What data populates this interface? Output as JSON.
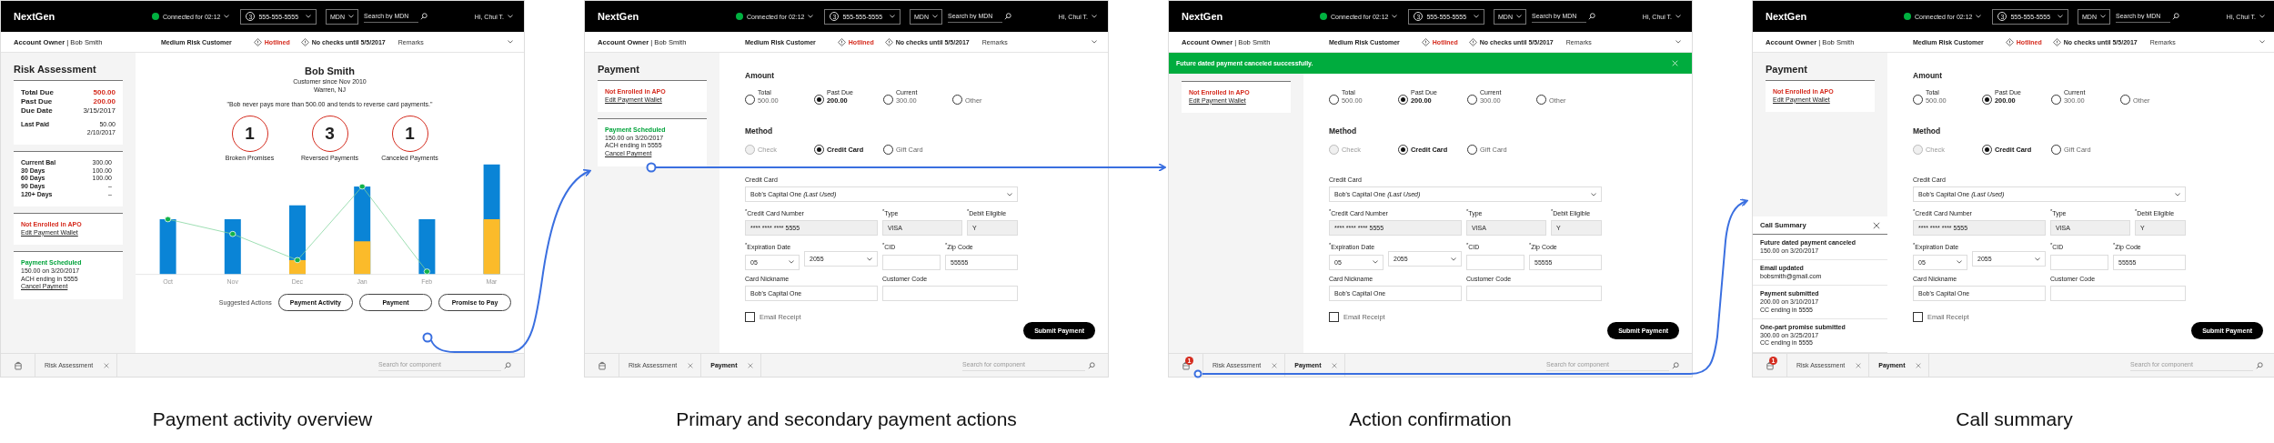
{
  "screens": [
    {
      "caption": "Payment activity overview",
      "header": {
        "app_name": "NextGen",
        "connection": "Connected for 02:12",
        "line": "3",
        "phone": "555-555-5555",
        "search_type": "MDN",
        "search_placeholder": "Search by MDN",
        "user": "Hi, Chui T."
      },
      "account_bar": {
        "owner": "**Account Owner** | Bob Smith",
        "risk": "Medium Risk Customer",
        "alerts": [
          {
            "text": "Hotlined",
            "kind": "danger"
          },
          {
            "text": "No checks until 5/5/2017",
            "kind": "info"
          }
        ],
        "remarks": "Remarks"
      },
      "sidebar": {
        "title": "Risk Assessment",
        "cards": [
          {
            "kind": "totals",
            "rows": [
              {
                "label": "Total Due",
                "value": "500.00",
                "alert": true
              },
              {
                "label": "Past Due",
                "value": "200.00",
                "alert": true
              },
              {
                "label": "Due Date",
                "value": "3/15/2017",
                "alert": false
              }
            ],
            "last_paid": {
              "label": "Last Paid",
              "lines": [
                "50.00",
                "2/10/2017"
              ]
            }
          },
          {
            "kind": "aging",
            "rows": [
              {
                "label": "Current Bal",
                "value": "300.00"
              },
              {
                "label": "30 Days",
                "value": "100.00"
              },
              {
                "label": "60 Days",
                "value": "100.00"
              },
              {
                "label": "90 Days",
                "value": "–"
              },
              {
                "label": "120+ Days",
                "value": "–"
              }
            ]
          },
          {
            "kind": "status",
            "positive": false,
            "status": "Not Enrolled in APO",
            "link": "Edit Payment Wallet"
          },
          {
            "kind": "status",
            "positive": true,
            "status": "Payment Scheduled",
            "lines": [
              "150.00 on 3/20/2017",
              "ACH ending in 5555"
            ],
            "link": "Cancel Payment"
          }
        ]
      },
      "main": {
        "kind": "risk",
        "name": "Bob Smith",
        "since": "Customer since Nov 2010",
        "location": "Warren, NJ",
        "quote": "\"Bob never pays more than 500.00 and tends to reverse card payments.\"",
        "stats": [
          {
            "value": "1",
            "label": "Broken Promises"
          },
          {
            "value": "3",
            "label": "Reversed Payments"
          },
          {
            "value": "1",
            "label": "Canceled Payments"
          }
        ],
        "chart_months": [
          "Oct",
          "Nov",
          "Dec",
          "Jan",
          "Feb",
          "Mar"
        ],
        "actions_label": "Suggested Actions",
        "actions": [
          "Payment Activity",
          "Payment",
          "Promise to Pay"
        ]
      },
      "bottom_bar": {
        "tabs": [
          {
            "label": "Risk Assessment",
            "selected": false
          }
        ],
        "search_placeholder": "Search for component"
      }
    },
    {
      "caption": "Primary and secondary payment actions",
      "header": {
        "app_name": "NextGen",
        "connection": "Connected for 02:12",
        "line": "3",
        "phone": "555-555-5555",
        "search_type": "MDN",
        "search_placeholder": "Search by MDN",
        "user": "Hi, Chui T."
      },
      "account_bar": {
        "owner": "**Account Owner** | Bob Smith",
        "risk": "Medium Risk Customer",
        "alerts": [
          {
            "text": "Hotlined",
            "kind": "danger"
          },
          {
            "text": "No checks until 5/5/2017",
            "kind": "info"
          }
        ],
        "remarks": "Remarks"
      },
      "sidebar": {
        "title": "Payment",
        "cards": [
          {
            "kind": "status",
            "positive": false,
            "status": "Not Enrolled in APO",
            "link": "Edit Payment Wallet"
          },
          {
            "kind": "status",
            "positive": true,
            "status": "Payment Scheduled",
            "lines": [
              "150.00 on 3/20/2017",
              "ACH ending in 5555"
            ],
            "link": "Cancel Payment"
          }
        ]
      },
      "main": {
        "kind": "payment",
        "amount_title": "Amount",
        "amounts": [
          {
            "label": "Total",
            "value": "500.00",
            "selected": false
          },
          {
            "label": "Past Due",
            "value": "200.00",
            "selected": true
          },
          {
            "label": "Current",
            "value": "300.00",
            "selected": false
          },
          {
            "label": "Other",
            "selected": false
          }
        ],
        "method_title": "Method",
        "methods": [
          {
            "label": "Check",
            "selected": false,
            "disabled": true
          },
          {
            "label": "Credit Card",
            "selected": true,
            "disabled": false
          },
          {
            "label": "Gift Card",
            "selected": false,
            "disabled": false
          }
        ],
        "card_label": "Credit Card",
        "card_value": "Bob's Capital One *(Last Used)*",
        "field_rows": [
          [
            {
              "label": "$^{*}$Credit Card Number",
              "value": "**** **** **** 5555",
              "kind": "readonly"
            },
            {
              "label": "$^{*}$Type",
              "value": "VISA",
              "kind": "readonly"
            },
            {
              "label": "$^{*}$Debit Eligible",
              "value": "Y",
              "kind": "readonly"
            }
          ],
          [
            {
              "label": "$^{*}$Expiration Date",
              "value": "05",
              "kind": "select"
            },
            {
              "value": "2055",
              "kind": "select"
            },
            {
              "label": "$^{*}$CID",
              "kind": "input"
            },
            {
              "label": "$^{*}$Zip Code",
              "value": "55555",
              "kind": "input"
            }
          ],
          [
            {
              "label": "Card Nickname",
              "value": "Bob's Capital One",
              "kind": "input"
            },
            {
              "label": "Customer Code",
              "kind": "input"
            }
          ]
        ],
        "email_receipt": {
          "label": "Email Receipt",
          "checked": false
        },
        "submit": "Submit Payment"
      },
      "bottom_bar": {
        "tabs": [
          {
            "label": "Risk Assessment",
            "selected": false
          },
          {
            "label": "Payment",
            "selected": true
          }
        ],
        "search_placeholder": "Search for component"
      }
    },
    {
      "caption": "Action confirmation",
      "header": {
        "app_name": "NextGen",
        "connection": "Connected for 02:12",
        "line": "3",
        "phone": "555-555-5555",
        "search_type": "MDN",
        "search_placeholder": "Search by MDN",
        "user": "Hi, Chui T."
      },
      "account_bar": {
        "owner": "**Account Owner** | Bob Smith",
        "risk": "Medium Risk Customer",
        "alerts": [
          {
            "text": "Hotlined",
            "kind": "danger"
          },
          {
            "text": "No checks until 5/5/2017",
            "kind": "info"
          }
        ],
        "remarks": "Remarks"
      },
      "banner": "Future dated payment canceled successfully.",
      "sidebar": {
        "cards": [
          {
            "kind": "status",
            "positive": false,
            "status": "Not Enrolled in APO",
            "link": "Edit Payment Wallet"
          }
        ]
      },
      "main": {
        "kind": "payment",
        "amounts": [
          {
            "label": "Total",
            "value": "500.00",
            "selected": false
          },
          {
            "label": "Past Due",
            "value": "200.00",
            "selected": true
          },
          {
            "label": "Current",
            "value": "300.00",
            "selected": false
          },
          {
            "label": "Other",
            "selected": false
          }
        ],
        "method_title": "Method",
        "methods": [
          {
            "label": "Check",
            "selected": false,
            "disabled": true
          },
          {
            "label": "Credit Card",
            "selected": true,
            "disabled": false
          },
          {
            "label": "Gift Card",
            "selected": false,
            "disabled": false
          }
        ],
        "card_label": "Credit Card",
        "card_value": "Bob's Capital One *(Last Used)*",
        "field_rows": [
          [
            {
              "label": "$^{*}$Credit Card Number",
              "value": "**** **** **** 5555",
              "kind": "readonly"
            },
            {
              "label": "$^{*}$Type",
              "value": "VISA",
              "kind": "readonly"
            },
            {
              "label": "$^{*}$Debit Eligible",
              "value": "Y",
              "kind": "readonly"
            }
          ],
          [
            {
              "label": "$^{*}$Expiration Date",
              "value": "05",
              "kind": "select"
            },
            {
              "value": "2055",
              "kind": "select"
            },
            {
              "label": "$^{*}$CID",
              "kind": "input"
            },
            {
              "label": "$^{*}$Zip Code",
              "value": "55555",
              "kind": "input"
            }
          ],
          [
            {
              "label": "Card Nickname",
              "value": "Bob's Capital One",
              "kind": "input"
            },
            {
              "label": "Customer Code",
              "kind": "input"
            }
          ]
        ],
        "email_receipt": {
          "label": "Email Receipt",
          "checked": false
        },
        "submit": "Submit Payment"
      },
      "bottom_bar": {
        "badge": "1",
        "tabs": [
          {
            "label": "Risk Assessment",
            "selected": false
          },
          {
            "label": "Payment",
            "selected": true
          }
        ],
        "search_placeholder": "Search for component"
      }
    },
    {
      "caption": "Call summary",
      "header": {
        "app_name": "NextGen",
        "connection": "Connected for 02:12",
        "line": "3",
        "phone": "555-555-5555",
        "search_type": "MDN",
        "search_placeholder": "Search by MDN",
        "user": "Hi, Chui T."
      },
      "account_bar": {
        "owner": "**Account Owner** | Bob Smith",
        "risk": "Medium Risk Customer",
        "alerts": [
          {
            "text": "Hotlined",
            "kind": "danger"
          },
          {
            "text": "No checks until 5/5/2017",
            "kind": "info"
          }
        ],
        "remarks": "Remarks"
      },
      "sidebar": {
        "title": "Payment",
        "cards": [
          {
            "kind": "status",
            "positive": false,
            "status": "Not Enrolled in APO",
            "link": "Edit Payment Wallet"
          }
        ],
        "call_summary": {
          "title": "Call Summary",
          "items": [
            {
              "title": "Future dated payment canceled",
              "lines": [
                "150.00 on 3/20/2017"
              ]
            },
            {
              "title": "Email updated",
              "lines": [
                "bobsmith@gmail.com"
              ]
            },
            {
              "title": "Payment submitted",
              "lines": [
                "200.00 on 3/10/2017",
                "CC ending in 5555"
              ]
            },
            {
              "title": "One-part promise submitted",
              "lines": [
                "300.00 on 3/25/2017",
                "CC ending in 5555"
              ]
            }
          ]
        }
      },
      "main": {
        "kind": "payment",
        "amount_title": "Amount",
        "amounts": [
          {
            "label": "Total",
            "value": "500.00",
            "selected": false
          },
          {
            "label": "Past Due",
            "value": "200.00",
            "selected": true
          },
          {
            "label": "Current",
            "value": "300.00",
            "selected": false
          },
          {
            "label": "Other",
            "selected": false
          }
        ],
        "method_title": "Method",
        "methods": [
          {
            "label": "Check",
            "selected": false,
            "disabled": true
          },
          {
            "label": "Credit Card",
            "selected": true,
            "disabled": false
          },
          {
            "label": "Gift Card",
            "selected": false,
            "disabled": false
          }
        ],
        "card_label": "Credit Card",
        "card_value": "Bob's Capital One *(Last Used)*",
        "field_rows": [
          [
            {
              "label": "$^{*}$Credit Card Number",
              "value": "**** **** **** 5555",
              "kind": "readonly"
            },
            {
              "label": "$^{*}$Type",
              "value": "VISA",
              "kind": "readonly"
            },
            {
              "label": "$^{*}$Debit Eligible",
              "value": "Y",
              "kind": "readonly"
            }
          ],
          [
            {
              "label": "$^{*}$Expiration Date",
              "value": "05",
              "kind": "select"
            },
            {
              "value": "2055",
              "kind": "select"
            },
            {
              "label": "$^{*}$CID",
              "kind": "input"
            },
            {
              "label": "$^{*}$Zip Code",
              "value": "55555",
              "kind": "input"
            }
          ],
          [
            {
              "label": "Card Nickname",
              "value": "Bob's Capital One",
              "kind": "input"
            },
            {
              "label": "Customer Code",
              "kind": "input"
            }
          ]
        ],
        "email_receipt": {
          "label": "Email Receipt",
          "checked": false
        },
        "submit": "Submit Payment"
      },
      "bottom_bar": {
        "badge": "1",
        "tabs": [
          {
            "label": "Risk Assessment",
            "selected": false
          },
          {
            "label": "Payment",
            "selected": true
          }
        ],
        "search_placeholder": "Search for component"
      }
    }
  ]
}
